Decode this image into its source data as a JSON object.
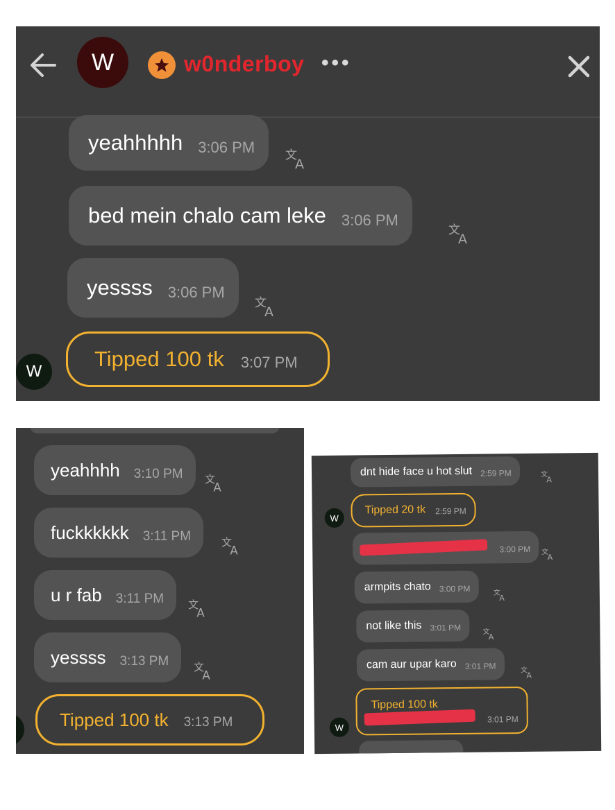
{
  "header": {
    "avatar_letter": "W",
    "username": "w0nderboy",
    "more": "•••"
  },
  "panel1": {
    "messages": [
      {
        "text": "yeahhhhh",
        "time": "3:06 PM"
      },
      {
        "text": "bed mein chalo cam leke",
        "time": "3:06 PM"
      },
      {
        "text": "yessss",
        "time": "3:06 PM"
      }
    ],
    "tip": {
      "text": "Tipped 100 tk",
      "time": "3:07 PM"
    },
    "avatar_letter": "W"
  },
  "panel2": {
    "messages": [
      {
        "text": "yeahhhh",
        "time": "3:10 PM"
      },
      {
        "text": "fuckkkkkk",
        "time": "3:11 PM"
      },
      {
        "text": "u r fab",
        "time": "3:11 PM"
      },
      {
        "text": "yessss",
        "time": "3:13 PM"
      }
    ],
    "tip": {
      "text": "Tipped 100 tk",
      "time": "3:13 PM"
    }
  },
  "panel3": {
    "messages": [
      {
        "text": "dnt hide face u hot slut",
        "time": "2:59 PM"
      },
      {
        "text": "",
        "time": "3:00 PM"
      },
      {
        "text": "armpits chato",
        "time": "3:00 PM"
      },
      {
        "text": "not like this",
        "time": "3:01 PM"
      },
      {
        "text": "cam aur upar karo",
        "time": "3:01 PM"
      }
    ],
    "tips": [
      {
        "text": "Tipped 20 tk",
        "time": "2:59 PM"
      },
      {
        "text": "Tipped 100 tk",
        "time": "3:01 PM"
      }
    ],
    "avatar_letter": "W"
  },
  "icons": {
    "translate": "translate-icon",
    "back": "back-arrow-icon",
    "close": "close-icon",
    "badge": "star-badge-icon"
  },
  "colors": {
    "background": "#3b3b3b",
    "bubble": "#535353",
    "tip_border": "#f2b230",
    "username": "#e3262e",
    "badge": "#f0913a",
    "redaction": "#e63246"
  }
}
